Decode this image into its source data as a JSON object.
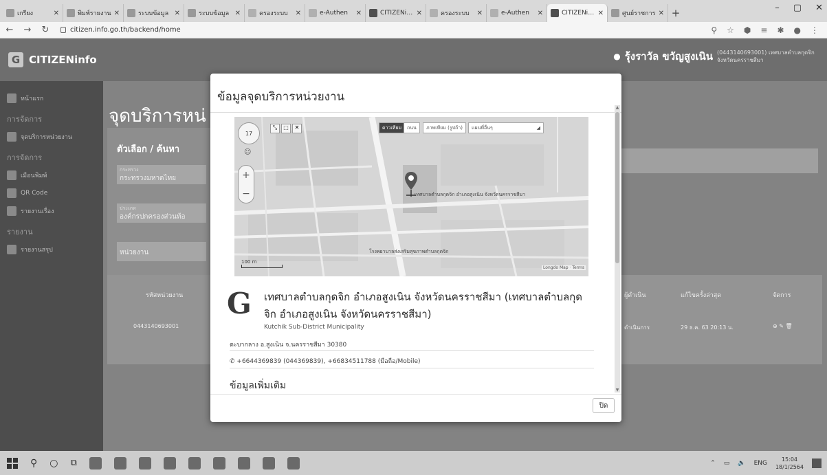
{
  "browser": {
    "tabs": [
      {
        "label": "เกรียง"
      },
      {
        "label": "พิมพ์รายงาน"
      },
      {
        "label": "ระบบข้อมูล"
      },
      {
        "label": "ระบบข้อมูล"
      },
      {
        "label": "ครองระบบ"
      },
      {
        "label": "e-Authen"
      },
      {
        "label": "CITIZENinfo"
      },
      {
        "label": "ครองระบบ"
      },
      {
        "label": "e-Authen"
      },
      {
        "label": "CITIZENinfo"
      },
      {
        "label": "ศูนย์ราชการ"
      }
    ],
    "url": "citizen.info.go.th/backend/home"
  },
  "app": {
    "name": "CITIZENinfo",
    "user_name": "รุ้งราวัล ขวัญสูงเนิน",
    "user_meta": "(0443140693001) เทศบาลตำบลกุดจิก จังหวัดนครราชสีมา"
  },
  "sidebar": {
    "items": [
      {
        "label": "หน้าแรก",
        "type": "item"
      },
      {
        "label": "การจัดการ",
        "type": "head"
      },
      {
        "label": "จุดบริการหน่วยงาน",
        "type": "item"
      },
      {
        "label": "การจัดการ",
        "type": "head"
      },
      {
        "label": "เมือนพิมพ์",
        "type": "item"
      },
      {
        "label": "QR Code",
        "type": "item"
      },
      {
        "label": "รายงานเรื่อง",
        "type": "item"
      },
      {
        "label": "รายงาน",
        "type": "head"
      },
      {
        "label": "รายงานสรุป",
        "type": "item"
      }
    ]
  },
  "page": {
    "title": "จุดบริการหน่",
    "filter_title": "ตัวเลือก / ค้นหา",
    "filter1_label": "กระทรวง",
    "filter1_value": "กระทรวงมหาดไทย",
    "filter2_label": "ประเภท",
    "filter2_value": "องค์กรปกครองส่วนท้อ",
    "filter3_value": "หน่วยงาน",
    "table_headers": [
      "รหัสหน่วยงาน",
      "ผู้ดำเนิน",
      "แก้ไขครั้งล่าสุด",
      "จัดการ"
    ],
    "row_id": "0443140693001",
    "row_status": "ดำเนินการ",
    "row_updated": "29 ธ.ค. 63 20:13 น."
  },
  "modal": {
    "title": "ข้อมูลจุดบริการหน่วยงาน",
    "map_types": [
      "ดาวเทียม",
      "ถนน",
      "ภาพเทียม (รูปถ้า)",
      "แผนที่อื่นๆ"
    ],
    "map_zoom": "17",
    "map_place_label": "เทศบาลตำบลกุดจิก อำเภอสูงเนิน จังหวัดนครราชสีมา",
    "map_school_label": "โรงพยาบาลส่งเสริมสุขภาพตำบลกุดจิก",
    "map_scale": "100 m",
    "map_credit": "Longdo Map · Terms",
    "logo": "G",
    "org_name": "เทศบาลตำบลกุดจิก อำเภอสูงเนิน จังหวัดนครราชสีมา (เทศบาลตำบลกุดจิก อำเภอสูงเนิน จังหวัดนครราชสีมา)",
    "org_en": "Kutchik Sub-District Municipality",
    "address": "ตะบากลาง อ.สูงเนิน จ.นครราชสีมา 30380",
    "phone": "+6644369839 (044369839), +66834511788 (มือถือ/Mobile)",
    "more_title": "ข้อมูลเพิ่มเติม",
    "close_label": "ปิด"
  },
  "taskbar": {
    "lang": "ENG",
    "time": "15:04",
    "date": "18/1/2564"
  },
  "colors": {
    "topbar": "#6e6e6e",
    "sidebar": "#4d4d4d",
    "overlay": "#838383"
  }
}
